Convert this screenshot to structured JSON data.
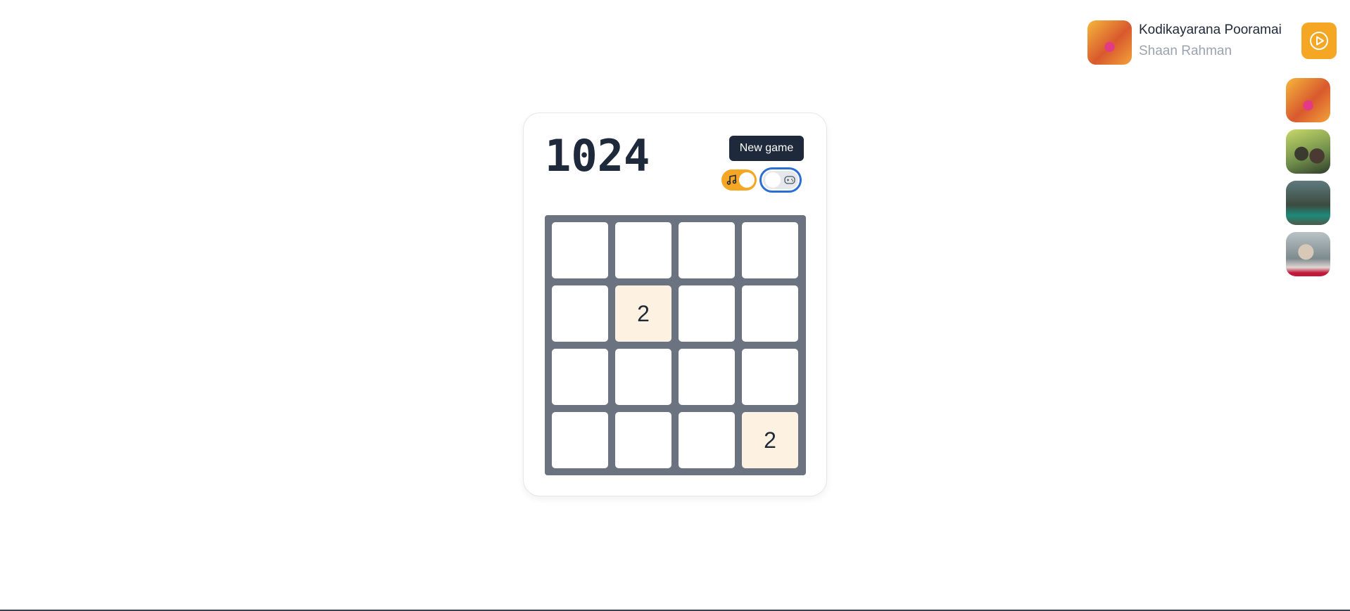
{
  "game": {
    "title": "1024",
    "new_game_label": "New game",
    "music_toggle": {
      "icon": "music-note-icon",
      "on": true,
      "color": "#f5a623"
    },
    "game_sound_toggle": {
      "icon": "gamepad-icon",
      "on": false,
      "focus_color": "#2b6fd6"
    },
    "board": [
      [
        "",
        "",
        "",
        ""
      ],
      [
        "",
        "2",
        "",
        ""
      ],
      [
        "",
        "",
        "",
        ""
      ],
      [
        "",
        "",
        "",
        "2"
      ]
    ]
  },
  "now_playing": {
    "title": "Kodikayarana Pooramai",
    "artist": "Shaan Rahman",
    "play_icon": "play-circle-icon",
    "accent": "#f5a623"
  },
  "queue_count": 4
}
